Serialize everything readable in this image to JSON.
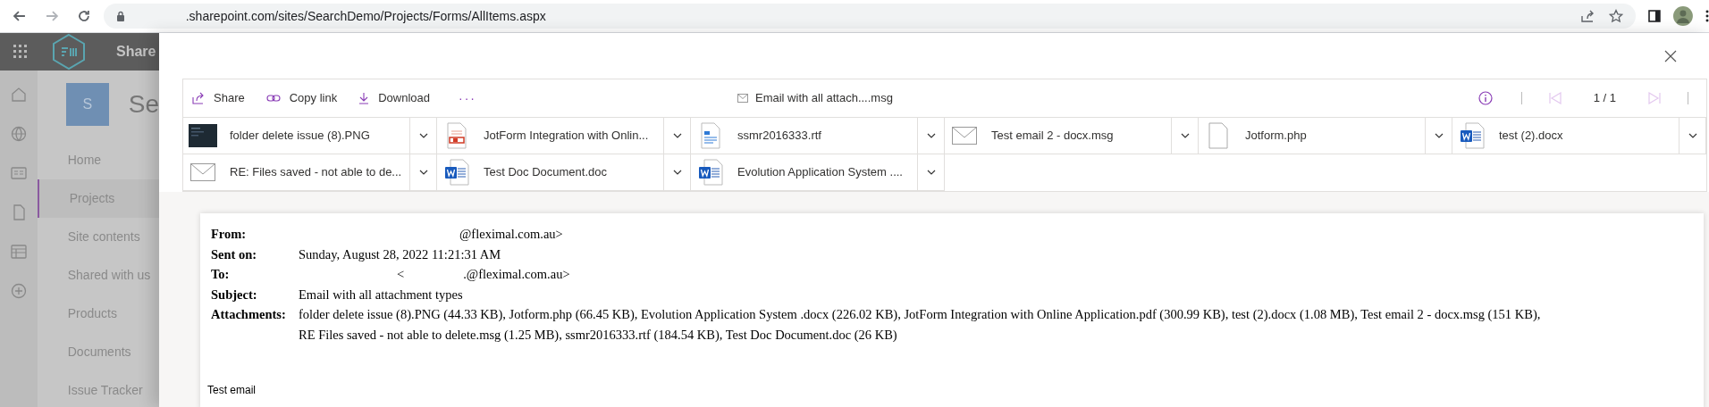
{
  "browser": {
    "url": ".sharepoint.com/sites/SearchDemo/Projects/Forms/AllItems.aspx"
  },
  "suite_bar": {
    "app_name": "Share"
  },
  "site": {
    "logo_letter": "S",
    "title": "Se"
  },
  "nav": [
    {
      "label": "Home",
      "selected": false
    },
    {
      "label": "Projects",
      "selected": true
    },
    {
      "label": "Site contents",
      "selected": false
    },
    {
      "label": "Shared with us",
      "selected": false
    },
    {
      "label": "Products",
      "selected": false
    },
    {
      "label": "Documents",
      "selected": false
    },
    {
      "label": "Issue Tracker",
      "selected": false
    }
  ],
  "toolbar": {
    "actions": [
      {
        "kind": "share",
        "label": "Share"
      },
      {
        "kind": "link",
        "label": "Copy link"
      },
      {
        "kind": "download",
        "label": "Download"
      },
      {
        "kind": "more",
        "label": "···"
      }
    ],
    "file_name": "Email with all attach....msg",
    "pager": {
      "text": "1 / 1",
      "prev_disabled": true,
      "next_disabled": true
    }
  },
  "attachments": [
    {
      "kind": "image",
      "name": "folder delete issue (8).PNG"
    },
    {
      "kind": "pdf",
      "name": "JotForm Integration with Onlin..."
    },
    {
      "kind": "rtf",
      "name": "ssmr2016333.rtf"
    },
    {
      "kind": "mail",
      "name": "Test email 2 - docx.msg"
    },
    {
      "kind": "file",
      "name": "Jotform.php"
    },
    {
      "kind": "word",
      "name": "test (2).docx"
    },
    {
      "kind": "mail",
      "name": "RE: Files saved - not able to de..."
    },
    {
      "kind": "word",
      "name": "Test Doc Document.doc"
    },
    {
      "kind": "word",
      "name": "Evolution Application System ...."
    }
  ],
  "email": {
    "fields": [
      {
        "label": "From:",
        "lines": [
          "@fleximal.com.au>"
        ],
        "redacted": true
      },
      {
        "label": "Sent on:",
        "lines": [
          "Sunday, August 28, 2022 11:21:31 AM"
        ],
        "redacted": false
      },
      {
        "label": "To:",
        "lines": [
          "<",
          ".@fleximal.com.au>"
        ],
        "redacted": true
      },
      {
        "label": "Subject:",
        "lines": [
          "Email with all attachment types"
        ],
        "redacted": false
      },
      {
        "label": "Attachments:",
        "lines": [
          "folder delete issue (8).PNG (44.33 KB), Jotform.php (66.45 KB), Evolution Application System .docx (226.02 KB), JotForm Integration with Online Application.pdf (300.99 KB), test (2).docx (1.08 MB), Test email 2 - docx.msg (151 KB),",
          "RE Files saved - not able to delete.msg (1.25 MB), ssmr2016333.rtf (184.54 KB), Test Doc Document.doc (26 KB)"
        ],
        "redacted": false
      }
    ],
    "body": "Test email"
  }
}
